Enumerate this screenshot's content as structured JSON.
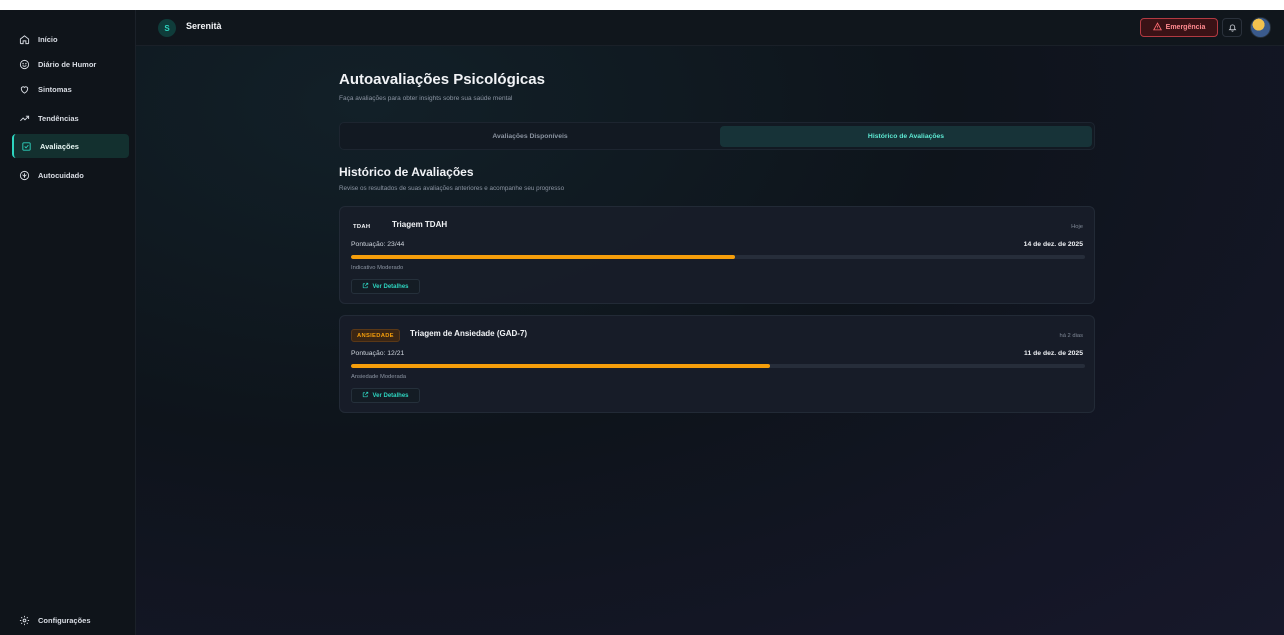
{
  "app": {
    "brand_initial": "S",
    "brand_name": "Serenità"
  },
  "sidebar": {
    "items": [
      {
        "label": "Início",
        "icon": "home-icon"
      },
      {
        "label": "Diário de Humor",
        "icon": "smile-icon"
      },
      {
        "label": "Sintomas",
        "icon": "heart-icon"
      },
      {
        "label": "Tendências",
        "icon": "trending-up-icon"
      },
      {
        "label": "Avaliações",
        "icon": "clipboard-check-icon",
        "active": true
      },
      {
        "label": "Autocuidado",
        "icon": "self-care-icon"
      }
    ],
    "settings_label": "Configurações"
  },
  "header": {
    "emergency_label": "Emergência"
  },
  "page": {
    "title": "Autoavaliações Psicológicas",
    "subtitle": "Faça avaliações para obter insights sobre sua saúde mental"
  },
  "tabs": [
    {
      "label": "Avaliações Disponíveis",
      "active": false
    },
    {
      "label": "Histórico de Avaliações",
      "active": true
    }
  ],
  "history": {
    "title": "Histórico de Avaliações",
    "subtitle": "Revise os resultados de suas avaliações anteriores e acompanhe seu progresso",
    "cards": [
      {
        "badge": "TDAH",
        "title": "Triagem TDAH",
        "when": "Hoje",
        "score_label": "Pontuação: 23/44",
        "score": 23,
        "max": 44,
        "date": "14 de dez. de 2025",
        "level": "Indicativo Moderado",
        "details_label": "Ver Detalhes"
      },
      {
        "badge": "ANSIEDADE",
        "title": "Triagem de Ansiedade (GAD-7)",
        "when": "há 2 dias",
        "score_label": "Pontuação: 12/21",
        "score": 12,
        "max": 21,
        "date": "11 de dez. de 2025",
        "level": "Ansiedade Moderada",
        "details_label": "Ver Detalhes"
      }
    ]
  },
  "colors": {
    "accent": "#2dd4bf",
    "progress": "#f59e0b",
    "danger": "#ef4444"
  }
}
